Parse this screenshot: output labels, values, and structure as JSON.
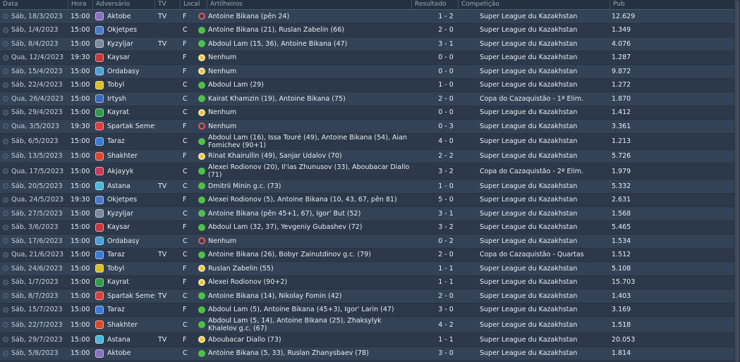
{
  "headers": {
    "date": "Data",
    "time": "Hora",
    "opponent": "Adversário",
    "tv": "TV",
    "venue": "Local",
    "scorers": "Artilheiros",
    "result": "Resultado",
    "competition": "Competição",
    "attendance": "Pub"
  },
  "outcome_colors": {
    "win": "#4ec14a",
    "draw": "#e8c43a",
    "loss": "#e05a5a"
  },
  "rows": [
    {
      "date": "Sáb, 18/3/2023",
      "time": "15:00",
      "opponent": "Aktobe",
      "crest": "#8c6fc4",
      "tv": "TV",
      "venue": "F",
      "outcome": "loss",
      "scorers": "Antoine Bikana (pên 24)",
      "result": "1 - 2",
      "competition": "Super League du Kazakhstan",
      "attendance": "12.629"
    },
    {
      "date": "Sáb, 1/4/2023",
      "time": "15:00",
      "opponent": "Okjetpes",
      "crest": "#4a78c8",
      "tv": "",
      "venue": "C",
      "outcome": "win",
      "scorers": "Antoine Bikana (21), Ruslan Zabelin (66)",
      "result": "2 - 0",
      "competition": "Super League du Kazakhstan",
      "attendance": "1.349"
    },
    {
      "date": "Sáb, 8/4/2023",
      "time": "15:00",
      "opponent": "Kyzyljar",
      "crest": "#7a8aa0",
      "tv": "TV",
      "venue": "F",
      "outcome": "win",
      "scorers": "Abdoul Lam (15, 36), Antoine Bikana (47)",
      "result": "3 - 1",
      "competition": "Super League du Kazakhstan",
      "attendance": "4.076"
    },
    {
      "date": "Qua, 12/4/2023",
      "time": "19:30",
      "opponent": "Kaysar",
      "crest": "#c8383a",
      "tv": "",
      "venue": "F",
      "outcome": "draw",
      "scorers": "Nenhum",
      "result": "0 - 0",
      "competition": "Super League du Kazakhstan",
      "attendance": "1.287"
    },
    {
      "date": "Sáb, 15/4/2023",
      "time": "15:00",
      "opponent": "Ordabasy",
      "crest": "#4aa0d8",
      "tv": "",
      "venue": "F",
      "outcome": "draw",
      "scorers": "Nenhum",
      "result": "0 - 0",
      "competition": "Super League du Kazakhstan",
      "attendance": "9.872"
    },
    {
      "date": "Sáb, 22/4/2023",
      "time": "15:00",
      "opponent": "Tobyl",
      "crest": "#d8c020",
      "tv": "",
      "venue": "C",
      "outcome": "win",
      "scorers": "Abdoul Lam (29)",
      "result": "1 - 0",
      "competition": "Super League du Kazakhstan",
      "attendance": "1.272"
    },
    {
      "date": "Qua, 26/4/2023",
      "time": "15:00",
      "opponent": "Irtysh",
      "crest": "#3a6ab8",
      "tv": "",
      "venue": "C",
      "outcome": "win",
      "scorers": "Kairat Khamzin (19), Antoine Bikana (75)",
      "result": "2 - 0",
      "competition": "Copa do Cazaquistão - 1ª Elim.",
      "attendance": "1.870"
    },
    {
      "date": "Sáb, 29/4/2023",
      "time": "15:00",
      "opponent": "Kayrat",
      "crest": "#2f9a4a",
      "tv": "",
      "venue": "C",
      "outcome": "draw",
      "scorers": "Nenhum",
      "result": "0 - 0",
      "competition": "Super League du Kazakhstan",
      "attendance": "1.412"
    },
    {
      "date": "Qua, 3/5/2023",
      "time": "19:30",
      "opponent": "Spartak Semey",
      "crest": "#d84040",
      "tv": "",
      "venue": "F",
      "outcome": "loss",
      "scorers": "Nenhum",
      "result": "0 - 3",
      "competition": "Super League du Kazakhstan",
      "attendance": "3.361"
    },
    {
      "date": "Sáb, 6/5/2023",
      "time": "15:00",
      "opponent": "Taraz",
      "crest": "#3a7ad8",
      "tv": "",
      "venue": "C",
      "outcome": "win",
      "scorers": "Abdoul Lam (16), Issa Touré (49), Antoine Bikana (54), Aian Fomichev (90+1)",
      "result": "4 - 0",
      "competition": "Super League du Kazakhstan",
      "attendance": "1.213"
    },
    {
      "date": "Sáb, 13/5/2023",
      "time": "15:00",
      "opponent": "Shakhter",
      "crest": "#d84a2a",
      "tv": "",
      "venue": "F",
      "outcome": "draw",
      "scorers": "Rinat Khairullin (49), Sanjar Udalov (70)",
      "result": "2 - 2",
      "competition": "Super League du Kazakhstan",
      "attendance": "5.726"
    },
    {
      "date": "Qua, 17/5/2023",
      "time": "15:00",
      "opponent": "Akjayyk",
      "crest": "#c83a5a",
      "tv": "",
      "venue": "C",
      "outcome": "win",
      "scorers": "Alexei Rodionov (20), Il'ias Zhunusov (33), Aboubacar Diallo (71)",
      "result": "3 - 2",
      "competition": "Copa do Cazaquistão - 2ª Elim.",
      "attendance": "1.979"
    },
    {
      "date": "Sáb, 20/5/2023",
      "time": "15:00",
      "opponent": "Astana",
      "crest": "#4ab8d8",
      "tv": "TV",
      "venue": "C",
      "outcome": "win",
      "scorers": "Dmitrii Minin g.c. (73)",
      "result": "1 - 0",
      "competition": "Super League du Kazakhstan",
      "attendance": "5.332"
    },
    {
      "date": "Qua, 24/5/2023",
      "time": "19:30",
      "opponent": "Okjetpes",
      "crest": "#4a78c8",
      "tv": "",
      "venue": "F",
      "outcome": "win",
      "scorers": "Alexei Rodionov (5), Antoine Bikana (10, 43, 67, pên 81)",
      "result": "5 - 0",
      "competition": "Super League du Kazakhstan",
      "attendance": "2.631"
    },
    {
      "date": "Sáb, 27/5/2023",
      "time": "15:00",
      "opponent": "Kyzyljar",
      "crest": "#7a8aa0",
      "tv": "",
      "venue": "C",
      "outcome": "win",
      "scorers": "Antoine Bikana (pên 45+1, 67), Igor' But (52)",
      "result": "3 - 1",
      "competition": "Super League du Kazakhstan",
      "attendance": "1.568"
    },
    {
      "date": "Sáb, 3/6/2023",
      "time": "15:00",
      "opponent": "Kaysar",
      "crest": "#c8383a",
      "tv": "",
      "venue": "F",
      "outcome": "win",
      "scorers": "Abdoul Lam (32, 37), Yevgeniy Gubashev (72)",
      "result": "3 - 2",
      "competition": "Super League du Kazakhstan",
      "attendance": "5.465"
    },
    {
      "date": "Sáb, 17/6/2023",
      "time": "15:00",
      "opponent": "Ordabasy",
      "crest": "#4aa0d8",
      "tv": "",
      "venue": "C",
      "outcome": "loss",
      "scorers": "Nenhum",
      "result": "0 - 2",
      "competition": "Super League du Kazakhstan",
      "attendance": "1.534"
    },
    {
      "date": "Qua, 21/6/2023",
      "time": "15:00",
      "opponent": "Taraz",
      "crest": "#3a7ad8",
      "tv": "TV",
      "venue": "C",
      "outcome": "win",
      "scorers": "Antoine Bikana (26), Bobyr Zainutdinov g.c. (79)",
      "result": "2 - 0",
      "competition": "Copa do Cazaquistão - Quartas",
      "attendance": "1.512"
    },
    {
      "date": "Sáb, 24/6/2023",
      "time": "15:00",
      "opponent": "Tobyl",
      "crest": "#d8c020",
      "tv": "",
      "venue": "F",
      "outcome": "draw",
      "scorers": "Ruslan Zabelin (55)",
      "result": "1 - 1",
      "competition": "Super League du Kazakhstan",
      "attendance": "5.108"
    },
    {
      "date": "Sáb, 1/7/2023",
      "time": "15:00",
      "opponent": "Kayrat",
      "crest": "#2f9a4a",
      "tv": "",
      "venue": "F",
      "outcome": "draw",
      "scorers": "Alexei Rodionov (90+2)",
      "result": "1 - 1",
      "competition": "Super League du Kazakhstan",
      "attendance": "15.703"
    },
    {
      "date": "Sáb, 8/7/2023",
      "time": "15:00",
      "opponent": "Spartak Semey",
      "crest": "#d84040",
      "tv": "TV",
      "venue": "C",
      "outcome": "win",
      "scorers": "Antoine Bikana (14), Nikolay Fomin (42)",
      "result": "2 - 0",
      "competition": "Super League du Kazakhstan",
      "attendance": "1.403"
    },
    {
      "date": "Sáb, 15/7/2023",
      "time": "15:00",
      "opponent": "Taraz",
      "crest": "#3a7ad8",
      "tv": "",
      "venue": "F",
      "outcome": "win",
      "scorers": "Abdoul Lam (5), Antoine Bikana (45+3), Igor' Larin (47)",
      "result": "3 - 0",
      "competition": "Super League du Kazakhstan",
      "attendance": "3.169"
    },
    {
      "date": "Sáb, 22/7/2023",
      "time": "15:00",
      "opponent": "Shakhter",
      "crest": "#d84a2a",
      "tv": "",
      "venue": "C",
      "outcome": "win",
      "scorers": "Abdoul Lam (5, 14), Antoine Bikana (25), Zhaksylyk Khalelov g.c. (67)",
      "result": "4 - 2",
      "competition": "Super League du Kazakhstan",
      "attendance": "1.518"
    },
    {
      "date": "Sáb, 29/7/2023",
      "time": "15:00",
      "opponent": "Astana",
      "crest": "#4ab8d8",
      "tv": "TV",
      "venue": "F",
      "outcome": "draw",
      "scorers": "Aboubacar Diallo (73)",
      "result": "1 - 1",
      "competition": "Super League du Kazakhstan",
      "attendance": "20.053"
    },
    {
      "date": "Sáb, 5/8/2023",
      "time": "15:00",
      "opponent": "Aktobe",
      "crest": "#8c6fc4",
      "tv": "",
      "venue": "C",
      "outcome": "win",
      "scorers": "Antoine Bikana (5, 33), Ruslan Zhanysbaev (78)",
      "result": "3 - 0",
      "competition": "Super League du Kazakhstan",
      "attendance": "1.814"
    }
  ]
}
